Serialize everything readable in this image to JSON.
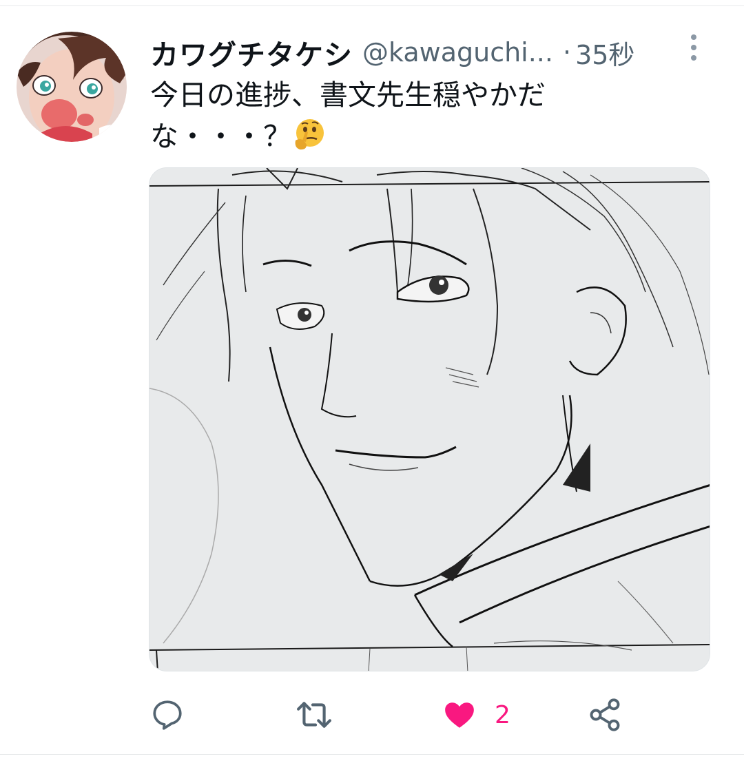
{
  "tweet": {
    "display_name": "カワグチタケシ",
    "handle": "@kawaguchi...",
    "separator": "·",
    "time": "35秒",
    "text": "今日の進捗、書文先生穏やかだな・・・？",
    "emoji": "thinking-face"
  },
  "actions": {
    "reply_icon": "reply-icon",
    "retweet_icon": "retweet-icon",
    "like_icon": "heart-icon",
    "like_count": "2",
    "share_icon": "share-icon"
  },
  "colors": {
    "like": "#f91880",
    "secondary_text": "#536471",
    "primary_text": "#0f1419",
    "icon": "#536471"
  }
}
